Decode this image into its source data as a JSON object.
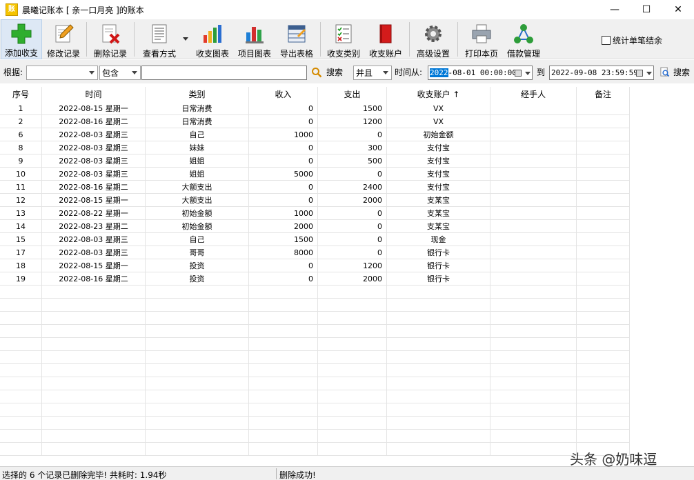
{
  "window": {
    "app_icon_glyph": "账",
    "title": "晨曦记账本   [ 亲一口月亮 ]的账本",
    "minimize": "—",
    "maximize": "☐",
    "close": "✕"
  },
  "toolbar": {
    "add": "添加收支",
    "edit": "修改记录",
    "delete": "删除记录",
    "view": "查看方式",
    "chart": "收支图表",
    "project_chart": "项目图表",
    "export": "导出表格",
    "categories": "收支类别",
    "accounts": "收支账户",
    "settings": "高级设置",
    "print": "打印本页",
    "loans": "借款管理",
    "stat_checkbox": "统计单笔结余"
  },
  "filter": {
    "basis_label": "根据:",
    "field_value": "",
    "match_value": "包含",
    "keyword_value": "",
    "search_label": "搜索",
    "logic_value": "并且",
    "time_from_label": "时间从:",
    "date_from_year": "2022",
    "date_from_rest": "-08-01 00:00:00",
    "to_label": "到",
    "date_to": "2022-09-08 23:59:59",
    "search2_label": "搜索"
  },
  "table": {
    "columns": [
      "序号",
      "时间",
      "类别",
      "收入",
      "支出",
      "收支账户 ↑",
      "经手人",
      "备注"
    ],
    "rows": [
      [
        "1",
        "2022-08-15 星期一",
        "日常消费",
        "0",
        "1500",
        "VX",
        "",
        ""
      ],
      [
        "2",
        "2022-08-16 星期二",
        "日常消费",
        "0",
        "1200",
        "VX",
        "",
        ""
      ],
      [
        "6",
        "2022-08-03 星期三",
        "自己",
        "1000",
        "0",
        "初始金额",
        "",
        ""
      ],
      [
        "8",
        "2022-08-03 星期三",
        "妹妹",
        "0",
        "300",
        "支付宝",
        "",
        ""
      ],
      [
        "9",
        "2022-08-03 星期三",
        "姐姐",
        "0",
        "500",
        "支付宝",
        "",
        ""
      ],
      [
        "10",
        "2022-08-03 星期三",
        "姐姐",
        "5000",
        "0",
        "支付宝",
        "",
        ""
      ],
      [
        "11",
        "2022-08-16 星期二",
        "大额支出",
        "0",
        "2400",
        "支付宝",
        "",
        ""
      ],
      [
        "12",
        "2022-08-15 星期一",
        "大额支出",
        "0",
        "2000",
        "支某宝",
        "",
        ""
      ],
      [
        "13",
        "2022-08-22 星期一",
        "初始金额",
        "1000",
        "0",
        "支某宝",
        "",
        ""
      ],
      [
        "14",
        "2022-08-23 星期二",
        "初始金额",
        "2000",
        "0",
        "支某宝",
        "",
        ""
      ],
      [
        "15",
        "2022-08-03 星期三",
        "自己",
        "1500",
        "0",
        "现金",
        "",
        ""
      ],
      [
        "17",
        "2022-08-03 星期三",
        "哥哥",
        "8000",
        "0",
        "银行卡",
        "",
        ""
      ],
      [
        "18",
        "2022-08-15 星期一",
        "投资",
        "0",
        "1200",
        "银行卡",
        "",
        ""
      ],
      [
        "19",
        "2022-08-16 星期二",
        "投资",
        "0",
        "2000",
        "银行卡",
        "",
        ""
      ]
    ]
  },
  "status": {
    "left": "选择的 6 个记录已删除完毕! 共耗时: 1.94秒",
    "right": "删除成功!"
  },
  "watermark": "头条 @奶味逗"
}
